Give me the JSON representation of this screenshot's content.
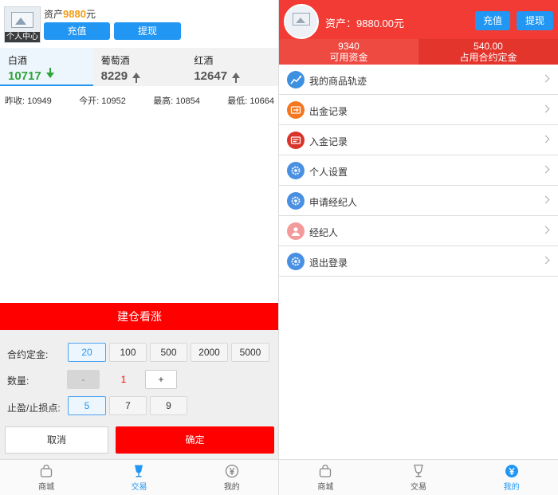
{
  "left": {
    "avatar_caption": "个人中心",
    "assets_label": "资产",
    "assets_value": "9880",
    "assets_unit": "元",
    "recharge_label": "充值",
    "withdraw_label": "提现",
    "tabs": [
      {
        "name": "白酒",
        "price": "10717",
        "trend": "down"
      },
      {
        "name": "葡萄酒",
        "price": "8229",
        "trend": "up"
      },
      {
        "name": "红酒",
        "price": "12647",
        "trend": "up"
      }
    ],
    "stats": [
      {
        "label": "昨收:",
        "value": "10949"
      },
      {
        "label": "今开:",
        "value": "10952"
      },
      {
        "label": "最高:",
        "value": "10854"
      },
      {
        "label": "最低:",
        "value": "10664"
      }
    ],
    "build_button": "建仓看涨",
    "deposit_label": "合约定金:",
    "deposit_options": [
      "20",
      "100",
      "500",
      "2000",
      "5000"
    ],
    "quantity_label": "数量:",
    "qty_minus": "-",
    "qty_value": "1",
    "qty_plus": "+",
    "stop_label": "止盈/止损点:",
    "stop_options": [
      "5",
      "7",
      "9"
    ],
    "cancel_label": "取消",
    "confirm_label": "确定",
    "tabbar": [
      "商城",
      "交易",
      "我的"
    ],
    "tabbar_active": "交易"
  },
  "right": {
    "assets_text": "资产：9880.00元",
    "recharge_label": "充值",
    "withdraw_label": "提现",
    "funds": [
      {
        "value": "9340",
        "label": "可用资金"
      },
      {
        "value": "540.00",
        "label": "占用合约定金"
      }
    ],
    "menu": [
      {
        "label": "我的商品轨迹",
        "icon": "track-icon",
        "color": "#3d8fe0"
      },
      {
        "label": "出金记录",
        "icon": "withdraw-record-icon",
        "color": "#f2771e"
      },
      {
        "label": "入金记录",
        "icon": "deposit-record-icon",
        "color": "#d9342b"
      },
      {
        "label": "个人设置",
        "icon": "settings-icon",
        "color": "#4a90e2"
      },
      {
        "label": "申请经纪人",
        "icon": "apply-broker-icon",
        "color": "#4a90e2"
      },
      {
        "label": "经纪人",
        "icon": "broker-icon",
        "color": "#f39a9a"
      },
      {
        "label": "退出登录",
        "icon": "logout-icon",
        "color": "#4a90e2"
      }
    ],
    "tabbar": [
      "商城",
      "交易",
      "我的"
    ],
    "tabbar_active": "我的"
  },
  "colors": {
    "accent_blue": "#2196f3",
    "accent_red": "#ff0000",
    "down_green": "#2ea33a",
    "asset_orange": "#f39c12"
  }
}
